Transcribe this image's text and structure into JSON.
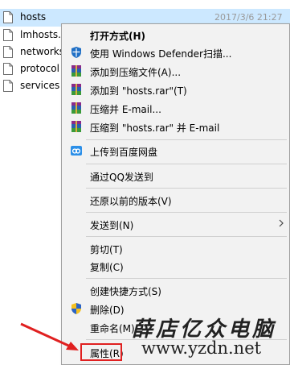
{
  "files": [
    {
      "name": "hosts",
      "date": "2017/3/6 21:27",
      "selected": true
    },
    {
      "name": "lmhosts.s",
      "date": ""
    },
    {
      "name": "networks",
      "date": ""
    },
    {
      "name": "protocol",
      "date": ""
    },
    {
      "name": "services",
      "date": ""
    }
  ],
  "menu": {
    "open_with": "打开方式(H)",
    "defender": "使用 Windows Defender扫描...",
    "add_archive": "添加到压缩文件(A)...",
    "add_rar": "添加到 \"hosts.rar\"(T)",
    "compress_email": "压缩并 E-mail...",
    "compress_rar_email": "压缩到 \"hosts.rar\" 并 E-mail",
    "upload_baidu": "上传到百度网盘",
    "send_qq": "通过QQ发送到",
    "restore_prev": "还原以前的版本(V)",
    "send_to": "发送到(N)",
    "cut": "剪切(T)",
    "copy": "复制(C)",
    "create_shortcut": "创建快捷方式(S)",
    "delete": "删除(D)",
    "rename": "重命名(M)",
    "properties": "属性(R)"
  },
  "watermark": {
    "text_cn": "薛店亿众电脑",
    "url": "www.yzdn.net"
  },
  "colors": {
    "selection": "#cce8ff",
    "highlight_box": "#e02020",
    "menu_bg": "#f2f2f2"
  }
}
